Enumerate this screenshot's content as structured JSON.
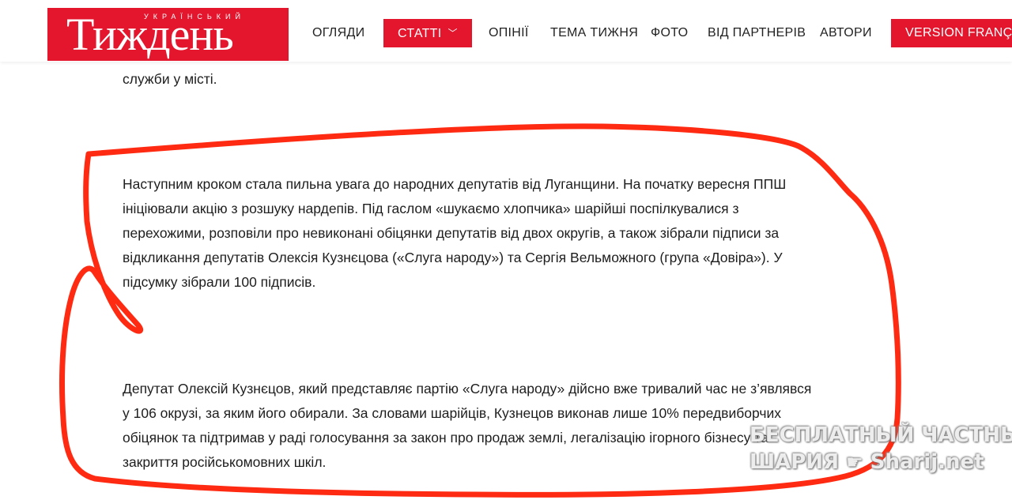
{
  "header": {
    "logo": {
      "sub": "УКРАЇНСЬКИЙ",
      "main": "Тиждень"
    },
    "nav": [
      {
        "label": "ОГЛЯДИ"
      },
      {
        "label": "СТАТТІ",
        "active": true
      },
      {
        "label": "ОПІНІЇ"
      },
      {
        "label": "ТЕМА ТИЖНЯ"
      },
      {
        "label": "ФОТО"
      },
      {
        "label": "ВІД ПАРТНЕРІВ"
      },
      {
        "label": "АВТОРИ"
      }
    ],
    "lang_button": "VERSION FRANÇAISE",
    "colors": {
      "brand": "#e3162e"
    }
  },
  "article": {
    "para_top_tail": "служби у місті.",
    "para_1": "Наступним кроком стала пильна увага до народних депутатів від Луганщини. На початку вересня ППШ ініціювали акцію з розшуку нардепів. Під гаслом «шукаємо хлопчика» шарійші поспілкувалися з перехожими, розповіли про невиконані обіцянки депутатів від двох округів, а також зібрали підписи за відкликання депутатів Олексія Кузнєцова («Слуга народу») та Сергія Вельможного (група «Довіра»). У підсумку зібрали 100 підписів.",
    "para_2": "Депутат Олексій Кузнєцов, який представляє партію «Слуга народу» дійсно вже тривалий час не з’являвся у 106 окрузі, за яким його обирали. За словами шарійців, Кузнецов виконав лише 10% передвиборчих обіцянок та підтримав у раді голосування за закон про продаж землі, легалізацію ігорного бізнесу та закриття російськомовних шкіл."
  },
  "watermark": {
    "line1": "БЕСПЛАТНЫЙ ЧАСТНЫЙ",
    "line2_left": "ШАРИЯ",
    "line2_right": "Sharij.net"
  },
  "annotation_color": "#ff2a12"
}
